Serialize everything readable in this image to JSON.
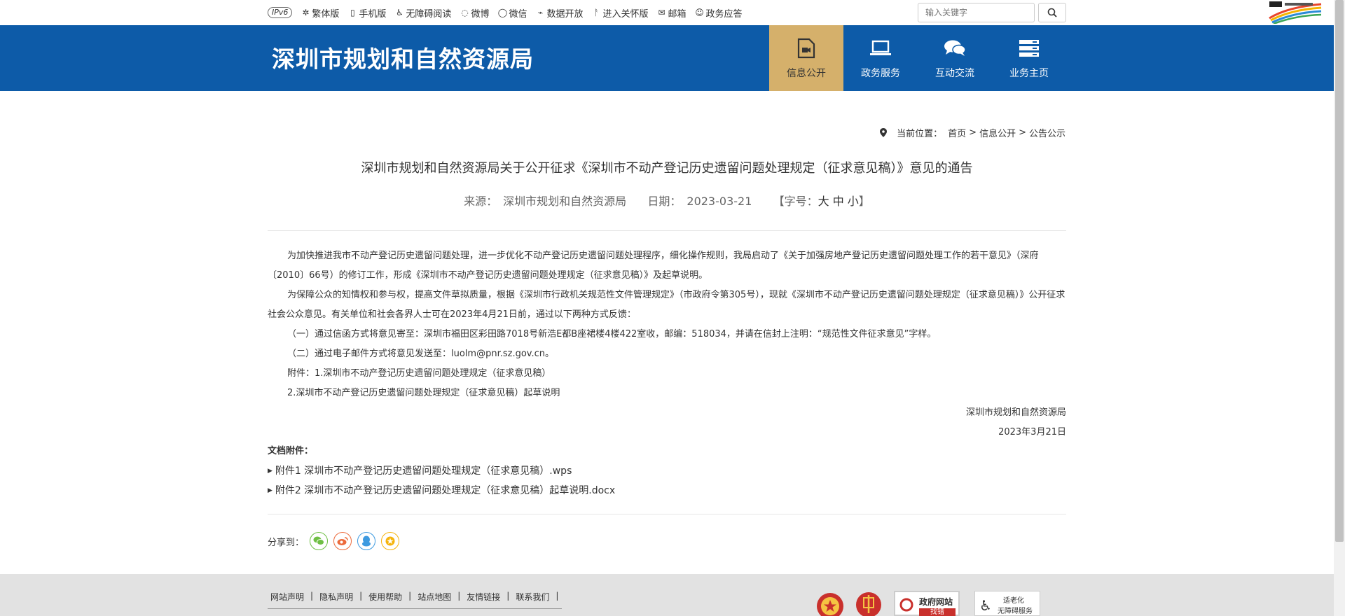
{
  "topbar": {
    "ipv6": "IPv6",
    "links": [
      {
        "icon": "gear-icon",
        "label": "繁体版"
      },
      {
        "icon": "mobile-icon",
        "label": "手机版"
      },
      {
        "icon": "accessibility-icon",
        "label": "无障碍阅读"
      },
      {
        "icon": "weibo-icon",
        "label": "微博"
      },
      {
        "icon": "wechat-icon",
        "label": "微信"
      },
      {
        "icon": "chart-icon",
        "label": "数据开放"
      },
      {
        "icon": "walker-icon",
        "label": "进入关怀版"
      },
      {
        "icon": "mail-icon",
        "label": "邮箱"
      },
      {
        "icon": "bot-icon",
        "label": "政务应答"
      }
    ],
    "search_placeholder": "输入关键字"
  },
  "header": {
    "title": "深圳市规划和自然资源局",
    "nav": [
      {
        "label": "信息公开",
        "active": true
      },
      {
        "label": "政务服务",
        "active": false
      },
      {
        "label": "互动交流",
        "active": false
      },
      {
        "label": "业务主页",
        "active": false
      }
    ]
  },
  "breadcrumb": {
    "prefix": "当前位置：",
    "items": [
      "首页",
      "信息公开",
      "公告公示"
    ],
    "sep": ">"
  },
  "article": {
    "title": "深圳市规划和自然资源局关于公开征求《深圳市不动产登记历史遗留问题处理规定（征求意见稿）》意见的通告",
    "source_label": "来源：",
    "source": "深圳市规划和自然资源局",
    "date_label": "日期：",
    "date": "2023-03-21",
    "fontsize_label": "【字号：",
    "fontsize_options": [
      "大",
      "中",
      "小"
    ],
    "fontsize_close": "】",
    "paragraphs": [
      "为加快推进我市不动产登记历史遗留问题处理，进一步优化不动产登记历史遗留问题处理程序，细化操作规则，我局启动了《关于加强房地产登记历史遗留问题处理工作的若干意见》（深府〔2010〕66号）的修订工作，形成《深圳市不动产登记历史遗留问题处理规定（征求意见稿）》及起草说明。",
      "为保障公众的知情权和参与权，提高文件草拟质量，根据《深圳市行政机关规范性文件管理规定》（市政府令第305号），现就《深圳市不动产登记历史遗留问题处理规定（征求意见稿）》公开征求社会公众意见。有关单位和社会各界人士可在2023年4月21日前，通过以下两种方式反馈：",
      "（一）通过信函方式将意见寄至：深圳市福田区彩田路7018号新浩E都B座裙楼4楼422室收，邮编：518034，并请在信封上注明：“规范性文件征求意见”字样。",
      "（二）通过电子邮件方式将意见发送至：luolm@pnr.sz.gov.cn。",
      "附件：1.深圳市不动产登记历史遗留问题处理规定（征求意见稿）",
      "2.深圳市不动产登记历史遗留问题处理规定（征求意见稿）起草说明"
    ],
    "signature_org": "深圳市规划和自然资源局",
    "signature_date": "2023年3月21日",
    "attachments_label": "文档附件：",
    "attachments": [
      "附件1 深圳市不动产登记历史遗留问题处理规定（征求意见稿）.wps",
      "附件2 深圳市不动产登记历史遗留问题处理规定（征求意见稿）起草说明.docx"
    ],
    "share_label": "分享到："
  },
  "footer": {
    "links": [
      "网站声明",
      "隐私声明",
      "使用帮助",
      "站点地图",
      "友情链接",
      "联系我们"
    ],
    "badge_report": "政府网站",
    "badge_report_sub": "找错",
    "badge_elderly_1": "适老化",
    "badge_elderly_2": "无障碍服务"
  },
  "colors": {
    "header_blue": "#0d5ba8",
    "nav_active": "#d5b06b",
    "footer_bg": "#e2e2e2"
  }
}
